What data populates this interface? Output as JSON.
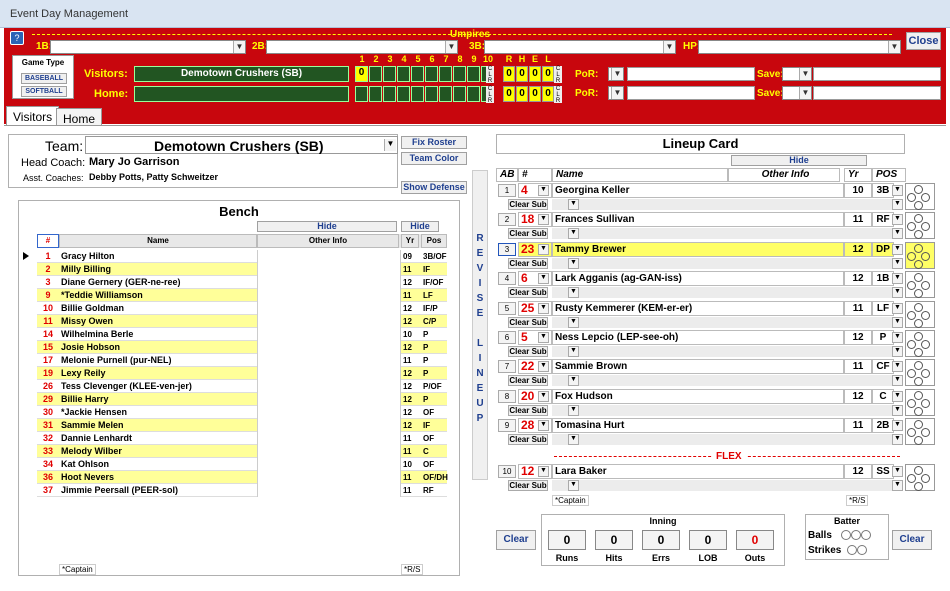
{
  "window": {
    "title": "Event Day Management",
    "close_label": "Close"
  },
  "umpires": {
    "title": "Umpires",
    "1b_label": "1B:",
    "2b_label": "2B:",
    "3b_label": "3B:",
    "hp_label": "HP:"
  },
  "game_type": {
    "title": "Game Type",
    "options": [
      "BASEBALL",
      "SOFTBALL"
    ]
  },
  "scoreboard": {
    "visitors_label": "Visitors:",
    "home_label": "Home:",
    "visitors_team": "Demotown Crushers (SB)",
    "innings": [
      "1",
      "2",
      "3",
      "4",
      "5",
      "6",
      "7",
      "8",
      "9",
      "10"
    ],
    "visitors_inning1": "0",
    "rhel_labels": [
      "R",
      "H",
      "E",
      "L"
    ],
    "visitors_rhel": [
      "0",
      "0",
      "0",
      "0"
    ],
    "home_rhel": [
      "0",
      "0",
      "0",
      "0"
    ],
    "clr_label": "CLR",
    "por_label": "PoR:",
    "save_label": "Save:"
  },
  "tabs": [
    "Visitors",
    "Home"
  ],
  "team": {
    "team_label": "Team:",
    "team_name": "Demotown Crushers (SB)",
    "head_coach_label": "Head Coach:",
    "head_coach": "Mary Jo Garrison",
    "asst_label": "Asst. Coaches:",
    "asst": "Debby Potts, Patty Schweitzer",
    "fix_roster": "Fix Roster",
    "team_color": "Team Color",
    "show_defense": "Show Defense"
  },
  "bench": {
    "title": "Bench",
    "hide1": "Hide",
    "hide2": "Hide",
    "headers": [
      "#",
      "Name",
      "Other Info",
      "Yr",
      "Pos"
    ],
    "rows": [
      {
        "num": "1",
        "name": "Gracy Hilton",
        "yr": "09",
        "pos": "3B/OF",
        "hl": false
      },
      {
        "num": "2",
        "name": "Milly Billing",
        "yr": "11",
        "pos": "IF",
        "hl": true
      },
      {
        "num": "3",
        "name": "Diane Gernery (GER-ne-ree)",
        "yr": "12",
        "pos": "IF/OF",
        "hl": false
      },
      {
        "num": "9",
        "name": "*Teddie Williamson",
        "yr": "11",
        "pos": "LF",
        "hl": true
      },
      {
        "num": "10",
        "name": "Billie Goldman",
        "yr": "12",
        "pos": "IF/P",
        "hl": false
      },
      {
        "num": "11",
        "name": "Missy Owen",
        "yr": "12",
        "pos": "C/P",
        "hl": true
      },
      {
        "num": "14",
        "name": "Wilhelmina Berle",
        "yr": "10",
        "pos": "P",
        "hl": false
      },
      {
        "num": "15",
        "name": "Josie Hobson",
        "yr": "12",
        "pos": "P",
        "hl": true
      },
      {
        "num": "17",
        "name": "Melonie Purnell (pur-NEL)",
        "yr": "11",
        "pos": "P",
        "hl": false
      },
      {
        "num": "19",
        "name": "Lexy Reily",
        "yr": "12",
        "pos": "P",
        "hl": true
      },
      {
        "num": "26",
        "name": "Tess Clevenger (KLEE-ven-jer)",
        "yr": "12",
        "pos": "P/OF",
        "hl": false
      },
      {
        "num": "29",
        "name": "Billie Harry",
        "yr": "12",
        "pos": "P",
        "hl": true
      },
      {
        "num": "30",
        "name": "*Jackie Hensen",
        "yr": "12",
        "pos": "OF",
        "hl": false
      },
      {
        "num": "31",
        "name": "Sammie Melen",
        "yr": "12",
        "pos": "IF",
        "hl": true
      },
      {
        "num": "32",
        "name": "Dannie Lenhardt",
        "yr": "11",
        "pos": "OF",
        "hl": false
      },
      {
        "num": "33",
        "name": "Melody Wilber",
        "yr": "11",
        "pos": "C",
        "hl": true
      },
      {
        "num": "34",
        "name": "Kat Ohlson",
        "yr": "10",
        "pos": "OF",
        "hl": false
      },
      {
        "num": "36",
        "name": "Hoot Nevers",
        "yr": "11",
        "pos": "OF/DH",
        "hl": true
      },
      {
        "num": "37",
        "name": "Jimmie Peersall (PEER-sol)",
        "yr": "11",
        "pos": "RF",
        "hl": false
      }
    ],
    "captain_note": "*Captain",
    "rs_note": "*R/S"
  },
  "revise": {
    "letters": [
      "R",
      "E",
      "V",
      "I",
      "S",
      "E",
      "",
      "L",
      "I",
      "N",
      "E",
      "U",
      "P"
    ]
  },
  "lineup": {
    "title": "Lineup Card",
    "hide": "Hide",
    "headers": [
      "AB",
      "#",
      "Name",
      "Other Info",
      "Yr",
      "POS"
    ],
    "clear_sub": "Clear Sub",
    "rows": [
      {
        "ab": "1",
        "num": "4",
        "name": "Georgina Keller",
        "yr": "10",
        "pos": "3B",
        "hl": false
      },
      {
        "ab": "2",
        "num": "18",
        "name": "Frances Sullivan",
        "yr": "11",
        "pos": "RF",
        "hl": false
      },
      {
        "ab": "3",
        "num": "23",
        "name": "Tammy Brewer",
        "yr": "12",
        "pos": "DP",
        "hl": true
      },
      {
        "ab": "4",
        "num": "6",
        "name": "Lark Agganis (ag-GAN-iss)",
        "yr": "12",
        "pos": "1B",
        "hl": false
      },
      {
        "ab": "5",
        "num": "25",
        "name": "Rusty Kemmerer (KEM-er-er)",
        "yr": "11",
        "pos": "LF",
        "hl": false
      },
      {
        "ab": "6",
        "num": "5",
        "name": "Ness Lepcio (LEP-see-oh)",
        "yr": "12",
        "pos": "P",
        "hl": false
      },
      {
        "ab": "7",
        "num": "22",
        "name": "Sammie Brown",
        "yr": "11",
        "pos": "CF",
        "hl": false
      },
      {
        "ab": "8",
        "num": "20",
        "name": "Fox Hudson",
        "yr": "12",
        "pos": "C",
        "hl": false
      },
      {
        "ab": "9",
        "num": "28",
        "name": "Tomasina Hurt",
        "yr": "11",
        "pos": "2B",
        "hl": false
      }
    ],
    "flex_label": "FLEX",
    "flex_row": {
      "ab": "10",
      "num": "12",
      "name": "Lara Baker",
      "yr": "12",
      "pos": "SS"
    },
    "captain_note": "*Captain",
    "rs_note": "*R/S"
  },
  "inning": {
    "title": "Inning",
    "labels": [
      "Runs",
      "Hits",
      "Errs",
      "LOB",
      "Outs"
    ],
    "values": [
      "0",
      "0",
      "0",
      "0",
      "0"
    ],
    "clear": "Clear"
  },
  "batter": {
    "title": "Batter",
    "balls": "Balls",
    "strikes": "Strikes",
    "clear": "Clear"
  },
  "colors": {
    "red": "#c8060d",
    "yellow": "#ffff99",
    "accent": "#e00000"
  }
}
